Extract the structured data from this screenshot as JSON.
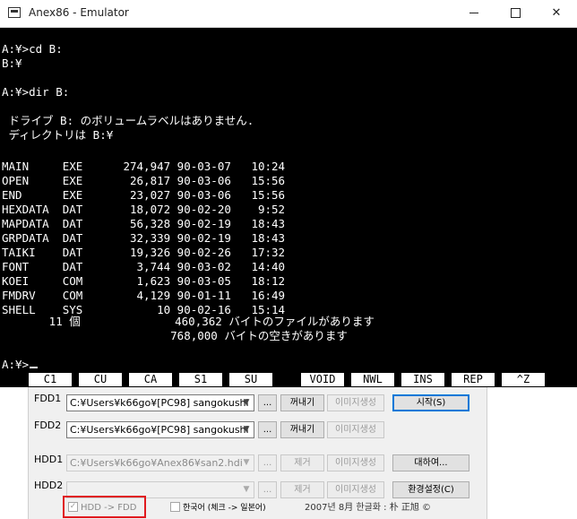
{
  "window": {
    "title": "Anex86 - Emulator",
    "controls": {
      "minimize": "—",
      "maximize": "☐",
      "close": "✕"
    }
  },
  "terminal": {
    "lines": [
      "",
      "A:¥>cd B:",
      "B:¥",
      "",
      "A:¥>dir B:",
      "",
      " ドライブ B: のボリュームラベルはありません.",
      " ディレクトリは B:¥",
      "",
      "",
      "MAIN     EXE      274,947 90-03-07   10:24",
      "OPEN     EXE       26,817 90-03-06   15:56",
      "END      EXE       23,027 90-03-06   15:56",
      "HEXDATA  DAT       18,072 90-02-20    9:52",
      "MAPDATA  DAT       56,328 90-02-19   18:43",
      "GRPDATA  DAT       32,339 90-02-19   18:43",
      "TAIKI    DAT       19,326 90-02-26   17:32",
      "FONT     DAT        3,744 90-03-02   14:40",
      "KOEI     COM        1,623 90-03-05   18:12",
      "FMDRV    COM        4,129 90-01-11   16:49",
      "SHELL    SYS           10 90-02-16   15:14",
      "       11 個              460,362 バイトのファイルがあります",
      "                         768,000 バイトの空きがあります",
      "",
      "A:¥>"
    ]
  },
  "function_keys": [
    "C1",
    "CU",
    "CA",
    "S1",
    "SU",
    "VOID",
    "NWL",
    "INS",
    "REP",
    "^Z"
  ],
  "panel": {
    "fdd1": {
      "label": "FDD1",
      "path": "C:¥Users¥k66go¥[PC98] sangokushi",
      "browse": "...",
      "eject": "꺼내기",
      "create_image": "이미지생성",
      "start": "시작(S)"
    },
    "fdd2": {
      "label": "FDD2",
      "path": "C:¥Users¥k66go¥[PC98] sangokushi",
      "browse": "...",
      "eject": "꺼내기",
      "create_image": "이미지생성"
    },
    "hdd1": {
      "label": "HDD1",
      "path": "C:¥Users¥k66go¥Anex86¥san2.hdi",
      "browse": "...",
      "remove": "제거",
      "create_image": "이미지생성",
      "swap": "대하여..."
    },
    "hdd2": {
      "label": "HDD2",
      "path": "",
      "browse": "...",
      "remove": "제거",
      "create_image": "이미지생성",
      "settings": "환경설정(C)"
    },
    "hdd_to_fdd": {
      "label": "HDD -> FDD",
      "checked": true
    },
    "korean": {
      "label": "한국어 (체크 -> 일본어)",
      "checked": false
    },
    "credit": "2007년 8月 한글화 : 朴 正旭 ©"
  },
  "colors": {
    "terminal_bg": "#000000",
    "terminal_fg": "#ffffff",
    "highlight": "#e0191e",
    "default_button_border": "#0078d7"
  }
}
